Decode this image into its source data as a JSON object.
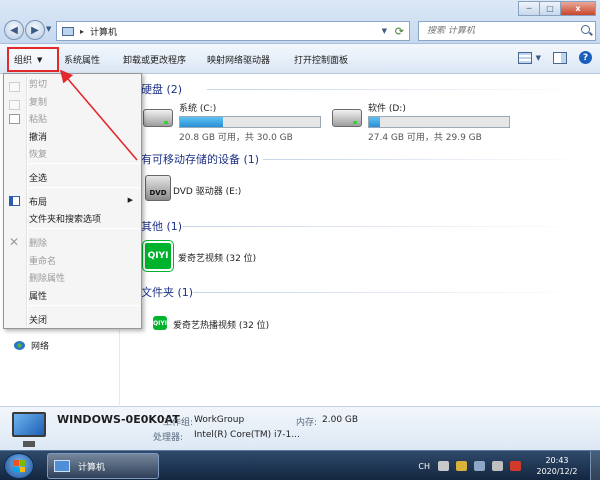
{
  "window": {
    "breadcrumb": "计算机",
    "search_placeholder": "搜索 计算机",
    "buttons": {
      "minimize": "─",
      "maximize": "□",
      "close": "x"
    }
  },
  "toolbar": {
    "organize": "组织",
    "system_properties": "系统属性",
    "uninstall": "卸载或更改程序",
    "map_drive": "映射网络驱动器",
    "control_panel": "打开控制面板",
    "help": "?"
  },
  "organize_menu": {
    "items": [
      {
        "label": "剪切",
        "enabled": false
      },
      {
        "label": "复制",
        "enabled": false
      },
      {
        "label": "粘贴",
        "enabled": false
      },
      {
        "label": "撤消",
        "enabled": true
      },
      {
        "label": "恢复",
        "enabled": false
      },
      {
        "label": "全选",
        "enabled": true
      },
      {
        "label": "布局",
        "enabled": true,
        "submenu": true
      },
      {
        "label": "文件夹和搜索选项",
        "enabled": true
      },
      {
        "label": "删除",
        "enabled": false
      },
      {
        "label": "重命名",
        "enabled": false
      },
      {
        "label": "删除属性",
        "enabled": false
      },
      {
        "label": "属性",
        "enabled": true
      },
      {
        "label": "关闭",
        "enabled": true
      }
    ]
  },
  "nav": {
    "network": "网络"
  },
  "content": {
    "groups": {
      "hard_disks": "硬盘 (2)",
      "removable": "有可移动存储的设备 (1)",
      "other": "其他 (1)",
      "folders": "文件夹 (1)"
    },
    "drives": [
      {
        "name": "系统 (C:)",
        "free": "20.8 GB 可用，共 30.0 GB",
        "used_fraction": 0.31
      },
      {
        "name": "软件 (D:)",
        "free": "27.4 GB 可用，共 29.9 GB",
        "used_fraction": 0.08
      }
    ],
    "dvd": {
      "icon_text": "DVD",
      "label": "DVD 驱动器 (E:)"
    },
    "iqiyi": {
      "icon_text": "QIYI",
      "label": "爱奇艺视频 (32 位)"
    },
    "iqiyi_folder": {
      "icon_text": "QIYI",
      "label": "爱奇艺热播视频 (32 位)"
    }
  },
  "details": {
    "computer_name": "WINDOWS-0E0K0AT",
    "workgroup_label": "工作组:",
    "workgroup": "WorkGroup",
    "memory_label": "内存:",
    "memory": "2.00 GB",
    "processor_label": "处理器:",
    "processor": "Intel(R) Core(TM) i7-1..."
  },
  "taskbar": {
    "active_window": "计算机",
    "lang": "CH",
    "time": "20:43",
    "date": "2020/12/2"
  },
  "colors": {
    "highlight_box": "#e22a2a",
    "group_header": "#1e3287",
    "drive_bar": "#2a8fd4",
    "iqiyi": "#00b32c"
  }
}
